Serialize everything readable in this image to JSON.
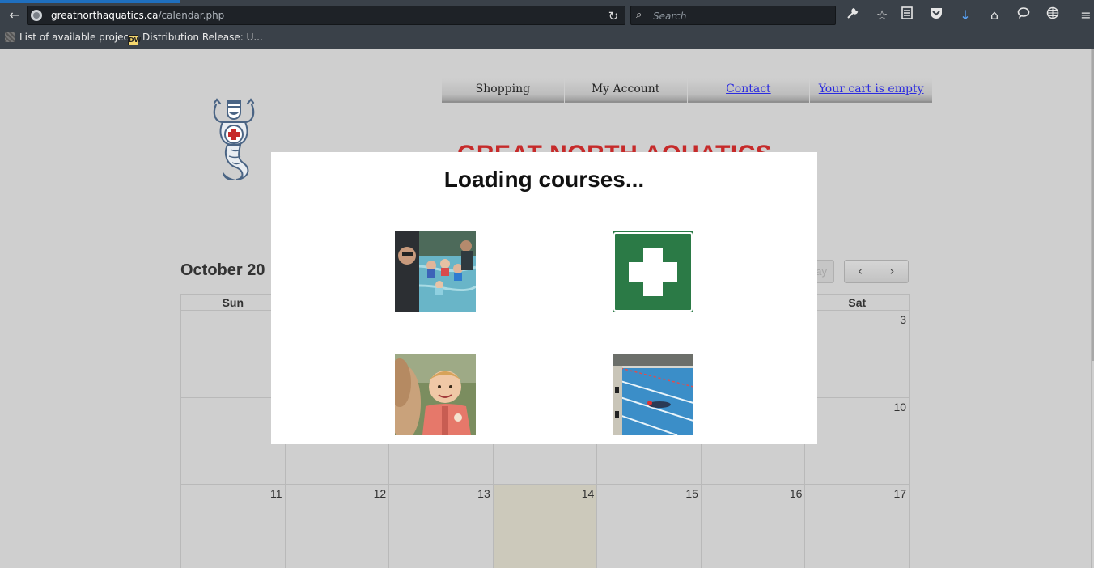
{
  "browser": {
    "url_domain": "greatnorthaquatics.ca",
    "url_path": "/calendar.php",
    "search_placeholder": "Search",
    "bookmarks": [
      {
        "label": "List of available projec..."
      },
      {
        "label": "Distribution Release: U..."
      }
    ],
    "toolbar_icons": [
      "wrench-icon",
      "star-icon",
      "reader-icon",
      "pocket-icon",
      "download-icon",
      "home-icon",
      "chat-icon",
      "globe-icon",
      "menu-icon"
    ],
    "accent_color": "#1f6fbf"
  },
  "site": {
    "menu": [
      {
        "label": "Shopping",
        "link": false
      },
      {
        "label": "My Account",
        "link": false
      },
      {
        "label": "Contact",
        "link": true
      },
      {
        "label": "Your cart is empty",
        "link": true
      }
    ],
    "title": "GREAT NORTH AQUATICS",
    "title_color": "#c62a2a"
  },
  "calendar": {
    "title": "October 20",
    "today_label": "ay",
    "prev": "‹",
    "next": "›",
    "headers": [
      "Sun",
      "",
      "",
      "",
      "",
      "",
      "Sat"
    ],
    "weeks": [
      [
        "",
        "",
        "",
        "",
        "",
        "",
        "3"
      ],
      [
        "",
        "",
        "",
        "",
        "",
        "",
        "10"
      ],
      [
        "11",
        "12",
        "13",
        "14",
        "15",
        "16",
        "17"
      ]
    ],
    "today_day": "14",
    "today_color": "#ccc9bb"
  },
  "modal": {
    "title": "Loading courses...",
    "images": [
      {
        "name": "swim-lesson-photo"
      },
      {
        "name": "first-aid-icon"
      },
      {
        "name": "child-lifejacket-photo"
      },
      {
        "name": "lap-pool-photo"
      }
    ]
  }
}
